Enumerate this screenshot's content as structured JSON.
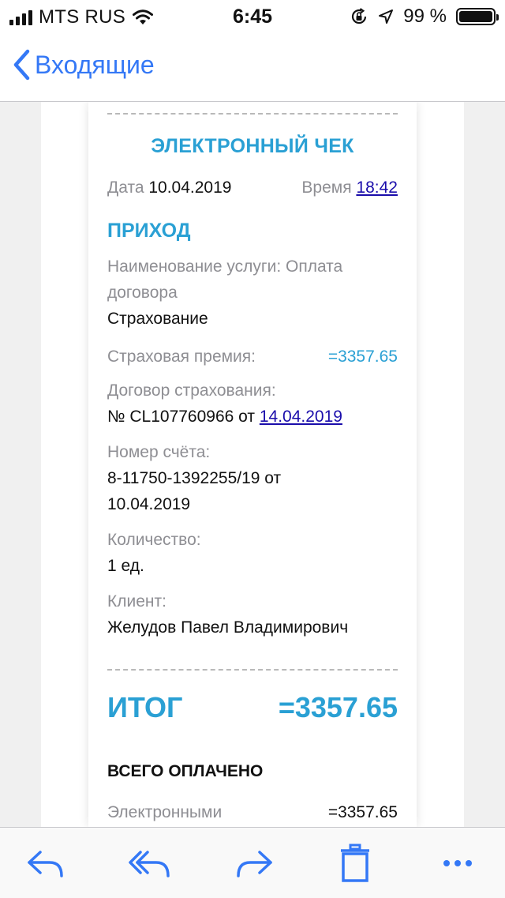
{
  "status_bar": {
    "carrier": "MTS RUS",
    "time": "6:45",
    "battery_percent": "99 %",
    "battery_level": 0.99,
    "signal_bars": 4
  },
  "nav": {
    "back_label": "Входящие"
  },
  "receipt": {
    "title": "ЭЛЕКТРОННЫЙ ЧЕК",
    "date_label": "Дата",
    "date_value": "10.04.2019",
    "time_label": "Время",
    "time_value": "18:42",
    "section_title": "ПРИХОД",
    "service_label": "Наименование услуги: Оплата договора",
    "service_value": "Страхование",
    "premium_label": "Страховая премия:",
    "premium_value": "=3357.65",
    "contract_label": "Договор страхования:",
    "contract_number": "№ CL107760966 от",
    "contract_date": "14.04.2019",
    "account_label": "Номер счёта:",
    "account_value": "8-11750-1392255/19 от 10.04.2019",
    "quantity_label": "Количество:",
    "quantity_value": "1 ед.",
    "client_label": "Клиент:",
    "client_value": "Желудов Павел Владимирович",
    "total_label": "ИТОГ",
    "total_value": "=3357.65",
    "paid_title": "ВСЕГО ОПЛАЧЕНО",
    "electronic_label": "Электронными",
    "electronic_value": "=3357.65"
  },
  "toolbar": {
    "icons": [
      "reply-icon",
      "reply-all-icon",
      "forward-icon",
      "trash-icon",
      "more-icon"
    ]
  },
  "colors": {
    "ios_blue": "#3478f6",
    "receipt_accent": "#2aa0d4",
    "link": "#1a0dab",
    "muted": "#8e8e93"
  }
}
